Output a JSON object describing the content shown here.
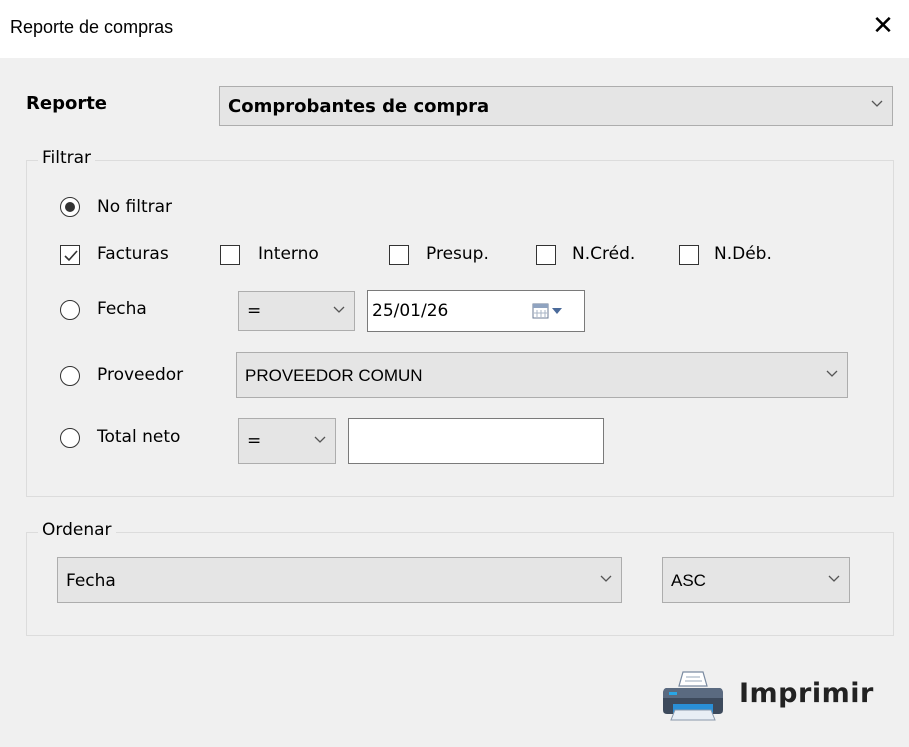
{
  "window": {
    "title": "Reporte de compras",
    "close_glyph": "✕"
  },
  "report": {
    "label": "Reporte",
    "selected": "Comprobantes de compra"
  },
  "filter": {
    "legend": "Filtrar",
    "no_filter_label": "No filtrar",
    "doc_types": [
      {
        "label": "Facturas",
        "checked": true
      },
      {
        "label": "Interno",
        "checked": false
      },
      {
        "label": "Presup.",
        "checked": false
      },
      {
        "label": "N.Créd.",
        "checked": false
      },
      {
        "label": "N.Déb.",
        "checked": false
      }
    ],
    "fecha": {
      "label": "Fecha",
      "operator": "=",
      "value": "25/01/26"
    },
    "proveedor": {
      "label": "Proveedor",
      "selected": "PROVEEDOR COMUN"
    },
    "total_neto": {
      "label": "Total neto",
      "operator": "=",
      "value": ""
    }
  },
  "sort": {
    "legend": "Ordenar",
    "field": "Fecha",
    "direction": "ASC"
  },
  "print": {
    "label": "Imprimir",
    "icon": "printer-icon"
  }
}
